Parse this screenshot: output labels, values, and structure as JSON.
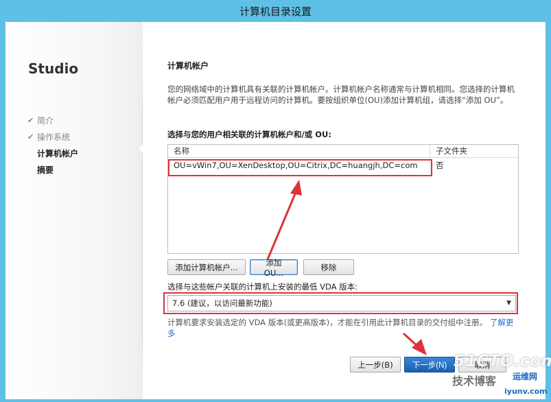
{
  "window": {
    "title": "计算机目录设置"
  },
  "sidebar": {
    "app_name": "Studio",
    "steps": [
      {
        "label": "简介",
        "state": "done"
      },
      {
        "label": "操作系统",
        "state": "done"
      },
      {
        "label": "计算机帐户",
        "state": "active"
      },
      {
        "label": "摘要",
        "state": "pending"
      }
    ]
  },
  "main": {
    "section_title": "计算机帐户",
    "description": "您的网络域中的计算机具有关联的计算机帐户。计算机帐户名称通常与计算机相同。您选择的计算机帐户必须匹配用户用于远程访问的计算机。要按组织单位(OU)添加计算机组，请选择“添加 OU”。",
    "list_label": "选择与您的用户相关联的计算机帐户和/或 OU:",
    "table": {
      "columns": [
        "名称",
        "子文件夹"
      ],
      "rows": [
        {
          "name": "OU=vWin7,OU=XenDesktop,OU=Citrix,DC=huangjh,DC=com",
          "subfolder": "否"
        }
      ]
    },
    "buttons": {
      "add_account": "添加计算机帐户...",
      "add_ou": "添加 OU...",
      "remove": "移除"
    },
    "vda_label": "选择与这些帐户关联的计算机上安装的最低 VDA 版本:",
    "vda_selected": "7.6 (建议，以访问最新功能)",
    "note": "计算机要求安装选定的 VDA 版本(或更高版本)，才能在引用此计算机目录的交付组中注册。",
    "note_link": "了解更多"
  },
  "footer": {
    "back": "上一步(B)",
    "next": "下一步(N)",
    "cancel": "取消"
  },
  "watermark": {
    "logo": "51CTO.com",
    "text": "技术博客",
    "sub": "运维网",
    "url": "iyunv.com"
  },
  "colors": {
    "titlebar": "#5ec0e6",
    "highlight": "#d9343b",
    "primary_button": "#1a5fb0",
    "link": "#1f6fd1"
  }
}
